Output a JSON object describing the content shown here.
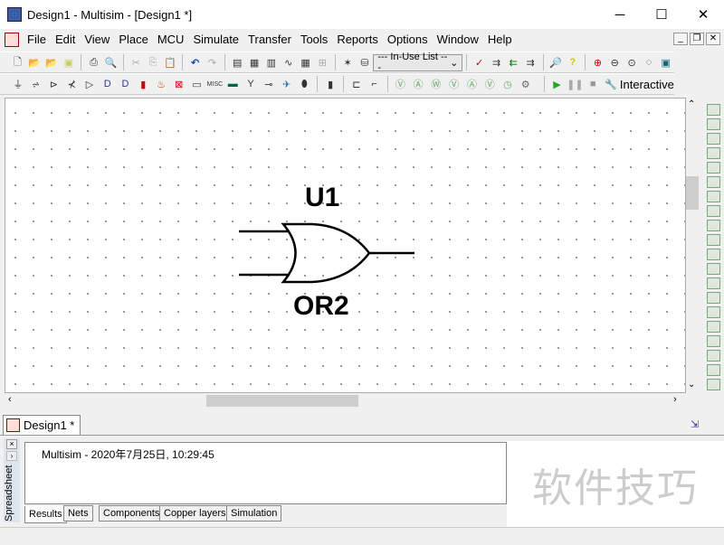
{
  "window": {
    "title": "Design1 - Multisim - [Design1 *]",
    "minimize": "─",
    "maximize": "☐",
    "close": "✕"
  },
  "menu": [
    "File",
    "Edit",
    "View",
    "Place",
    "MCU",
    "Simulate",
    "Transfer",
    "Tools",
    "Reports",
    "Options",
    "Window",
    "Help"
  ],
  "toolbar": {
    "in_use_list": "--- In-Use List ---",
    "interactive": "Interactive"
  },
  "schematic": {
    "ref": "U1",
    "part": "OR2"
  },
  "document_tab": "Design1 *",
  "spreadsheet": {
    "title": "Spreadsheet",
    "log": "Multisim  -  2020年7月25日, 10:29:45",
    "tabs": [
      "Results",
      "Nets",
      "Components",
      "Copper layers",
      "Simulation"
    ],
    "active_tab": "Results"
  },
  "watermark": "软件技巧"
}
